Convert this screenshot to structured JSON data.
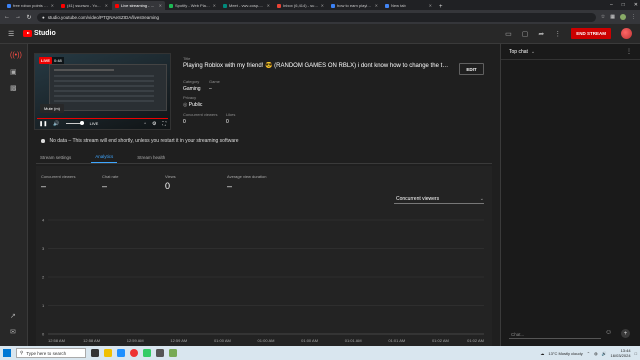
{
  "browser": {
    "tabs": [
      {
        "label": "free robux points - Search",
        "color": "#3b82f6",
        "active": false
      },
      {
        "label": "(41) ssunwo - YouTube",
        "color": "#ff0000",
        "active": false
      },
      {
        "label": "Live streaming - YouTube",
        "color": "#ff0000",
        "active": true
      },
      {
        "label": "Spotify - Web Player: Mu",
        "color": "#1db954",
        "active": false
      },
      {
        "label": "Meet - vwv-cosp-hwf",
        "color": "#00897b",
        "active": false
      },
      {
        "label": "Inbox (6,414) - sud6251",
        "color": "#ea4335",
        "active": false
      },
      {
        "label": "how to earn playing vid",
        "color": "#3b82f6",
        "active": false
      },
      {
        "label": "New tab",
        "color": "#4285f4",
        "active": false
      }
    ],
    "url": "studio.youtube.com/video/PTQNAeSZIDA/livestreaming"
  },
  "header": {
    "logo_text": "Studio",
    "end_stream_label": "END STREAM"
  },
  "preview": {
    "live_badge": "LIVE",
    "time": "0:48",
    "mute_chip": "Mute (m)",
    "live_label": "LIVE"
  },
  "stream_info": {
    "title_label": "Title",
    "title": "Playing Roblox with my friend! 😎 (RANDOM GAMES ON RBLX) i dont know how to change the thu...",
    "category_label": "Category",
    "category": "Gaming",
    "game_label": "Game",
    "game": "–",
    "privacy_label": "Privacy",
    "privacy": "Public",
    "concurrent_label": "Concurrent viewers",
    "concurrent": "0",
    "likes_label": "Likes",
    "likes": "0",
    "edit_label": "EDIT"
  },
  "status": {
    "message": "No data – This stream will end shortly, unless you restart it in your streaming software"
  },
  "tabs": [
    {
      "label": "Stream settings",
      "active": false
    },
    {
      "label": "Analytics",
      "active": true
    },
    {
      "label": "Stream health",
      "active": false
    }
  ],
  "stats": [
    {
      "label": "Concurrent viewers",
      "value": "–"
    },
    {
      "label": "Chat rate",
      "value": "–"
    },
    {
      "label": "Views",
      "value": "0"
    },
    {
      "label": "Average view duration",
      "value": "–"
    }
  ],
  "metric_select": "Concurrent viewers",
  "chart_data": {
    "type": "line",
    "y_ticks": [
      "0",
      "1",
      "2",
      "3",
      "4"
    ],
    "ylim": [
      0,
      4
    ],
    "x": [
      "12:58 AM",
      "12:58 AM",
      "12:59 AM",
      "12:59 AM",
      "01:00 AM",
      "01:00 AM",
      "01:00 AM",
      "01:01 AM",
      "01:01 AM",
      "01:02 AM",
      "01:02 AM"
    ],
    "series": [],
    "grid": true,
    "accent": "#3ea6ff"
  },
  "chat": {
    "header": "Top chat",
    "placeholder": "Chat..."
  },
  "taskbar": {
    "search_placeholder": "Type here to search",
    "weather": "13°C  Mostly cloudy",
    "time": "13:44",
    "date": "16/03/2024"
  }
}
